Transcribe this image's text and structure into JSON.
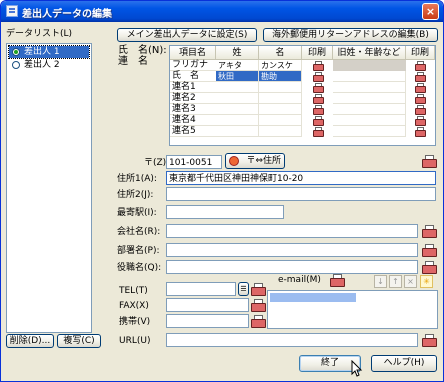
{
  "window": {
    "title": "差出人データの編集"
  },
  "datalist": {
    "label": "データリスト(L)",
    "items": [
      {
        "label": "差出人 1",
        "selected": true
      },
      {
        "label": "差出人 2",
        "selected": false
      }
    ]
  },
  "buttons": {
    "main_sender": "メイン差出人データに設定(S)",
    "overseas": "海外郵便用リターンアドレスの編集(B)",
    "delete": "削除(D)...",
    "copy": "複写(C)",
    "finish": "終了",
    "help": "ヘルプ(H)",
    "postal_search": "〒⇔住所"
  },
  "name_section": {
    "label_line1": "氏　名(N):",
    "label_line2": "連　名"
  },
  "grid": {
    "headers": [
      "項目名",
      "姓",
      "名",
      "印刷",
      "旧姓・年齢など",
      "印刷"
    ],
    "rows": [
      {
        "label": "フリガナ",
        "sei": "アキタ",
        "mei": "カンスケ",
        "print1": true,
        "print2": true
      },
      {
        "label": "氏　名",
        "sei": "秋田",
        "mei": "勘助",
        "print1": true,
        "print2": true,
        "highlight": true
      },
      {
        "label": "連名1",
        "sei": "",
        "mei": "",
        "print1": true,
        "print2": true
      },
      {
        "label": "連名2",
        "sei": "",
        "mei": "",
        "print1": true,
        "print2": true
      },
      {
        "label": "連名3",
        "sei": "",
        "mei": "",
        "print1": true,
        "print2": true
      },
      {
        "label": "連名4",
        "sei": "",
        "mei": "",
        "print1": true,
        "print2": true
      },
      {
        "label": "連名5",
        "sei": "",
        "mei": "",
        "print1": true,
        "print2": true
      }
    ]
  },
  "fields": {
    "postal": {
      "label": "〒(Z)",
      "value": "101-0051"
    },
    "address1": {
      "label": "住所1(A):",
      "value": "東京都千代田区神田神保町10-20"
    },
    "address2": {
      "label": "住所2(J):",
      "value": ""
    },
    "nearest_station": {
      "label": "最寄駅(I):",
      "value": ""
    },
    "company": {
      "label": "会社名(R):",
      "value": ""
    },
    "department": {
      "label": "部署名(P):",
      "value": ""
    },
    "title": {
      "label": "役職名(Q):",
      "value": ""
    },
    "tel": {
      "label": "TEL(T)",
      "value": ""
    },
    "fax": {
      "label": "FAX(X)",
      "value": ""
    },
    "mobile": {
      "label": "携帯(V)",
      "value": ""
    },
    "url": {
      "label": "URL(U)",
      "value": ""
    }
  },
  "email": {
    "label": "e-mail(M)"
  },
  "icons": {
    "print": "printer-icon",
    "tel_book": "phonebook-icon",
    "add": "star-icon",
    "up": "arrow-up-icon",
    "down": "arrow-down-icon",
    "remove": "close-icon"
  }
}
